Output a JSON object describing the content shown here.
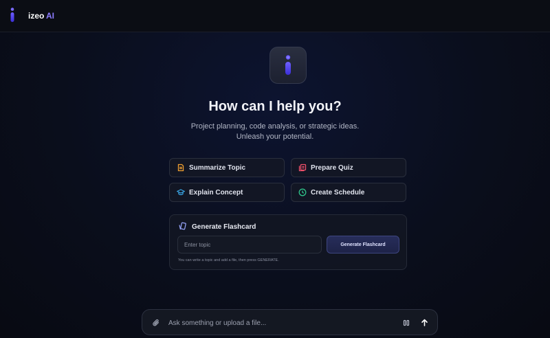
{
  "app": {
    "brand_name": "izeo",
    "brand_suffix": "AI",
    "accent_color": "#8b7bff",
    "logo_icon": "i-logo-icon"
  },
  "hero": {
    "icon": "i-logo-icon",
    "headline": "How can I help you?",
    "subline_1": "Project planning, code analysis, or strategic ideas.",
    "subline_2": "Unleash your potential."
  },
  "quick_actions": [
    {
      "label": "Summarize Topic",
      "icon": "document-icon",
      "color": "#f0a030"
    },
    {
      "label": "Prepare Quiz",
      "icon": "quiz-cards-icon",
      "color": "#f0506a"
    },
    {
      "label": "Explain Concept",
      "icon": "graduation-cap-icon",
      "color": "#3aa8e8"
    },
    {
      "label": "Create Schedule",
      "icon": "clock-icon",
      "color": "#2fc48a"
    }
  ],
  "flashcard": {
    "title": "Generate Flashcard",
    "icon": "flashcard-icon",
    "input_placeholder": "Enter topic",
    "button_label": "Generate Flashcard",
    "hint": "You can write a topic and add a file, then press GENERATE."
  },
  "composer": {
    "placeholder": "Ask something or upload a file...",
    "attach_icon": "paperclip-icon",
    "pause_icon": "pause-icon",
    "send_icon": "arrow-up-icon"
  }
}
